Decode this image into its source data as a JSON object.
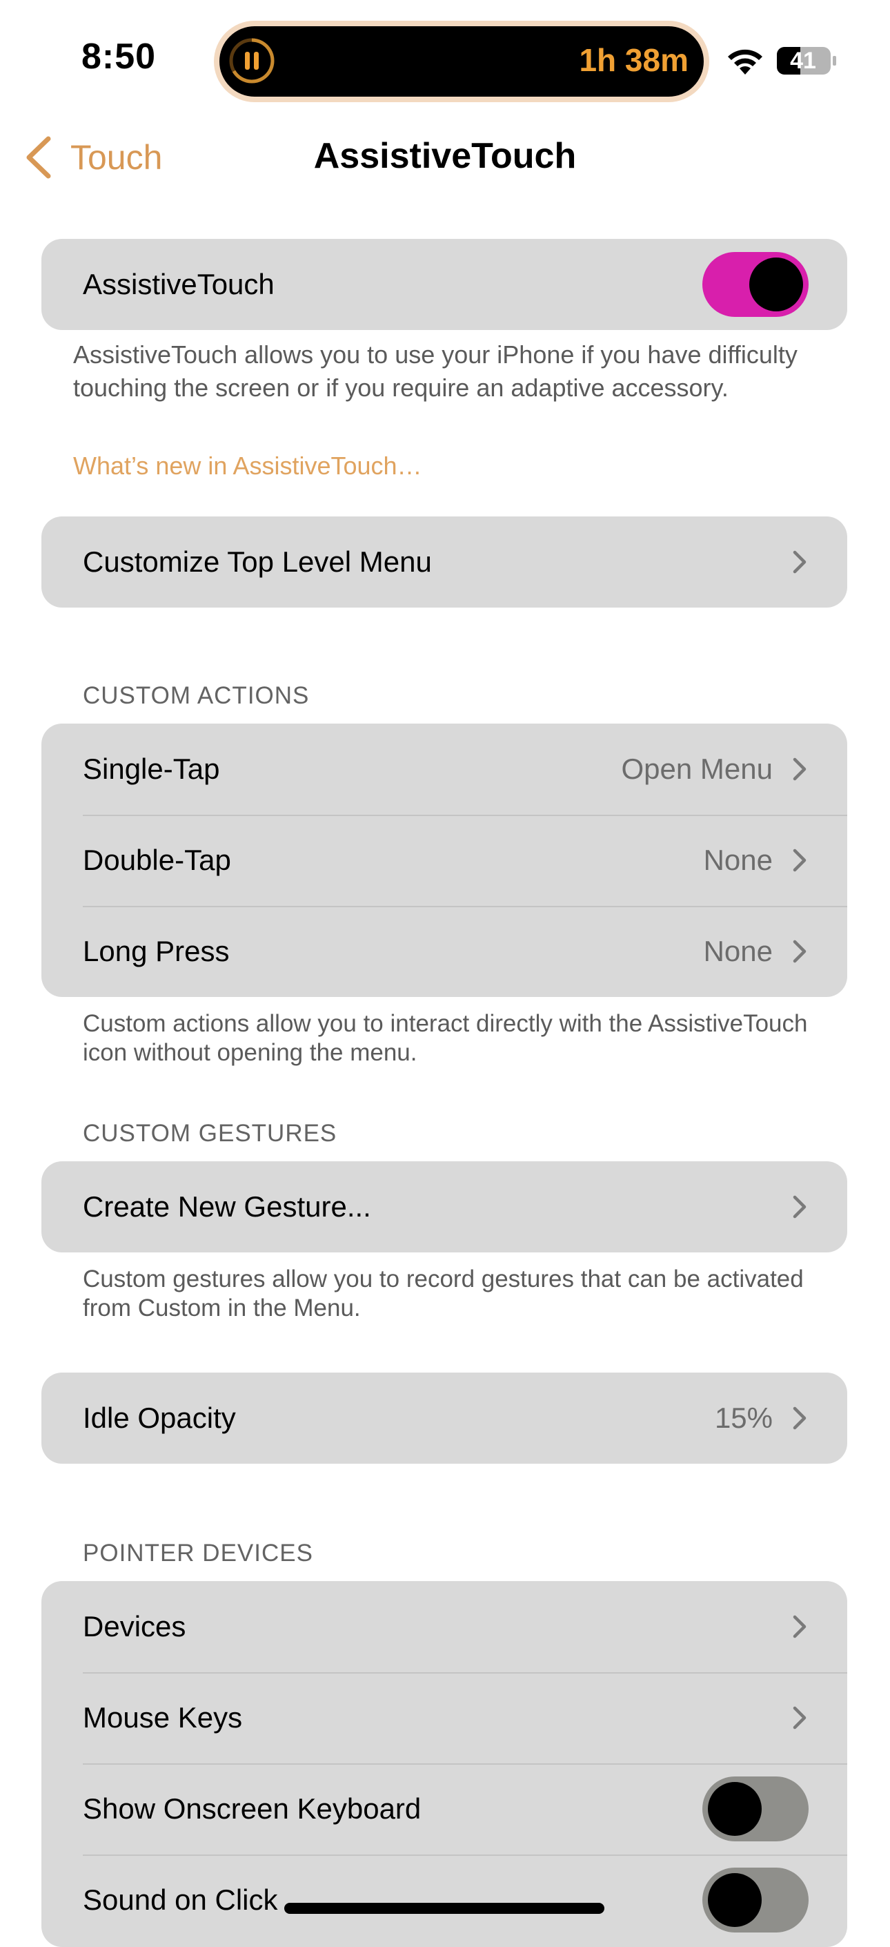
{
  "status_bar": {
    "time": "8:50",
    "live_activity_timer": "1h 38m",
    "battery_level": "41"
  },
  "nav": {
    "back_label": "Touch",
    "title": "AssistiveTouch"
  },
  "main_toggle": {
    "label": "AssistiveTouch",
    "on": true,
    "description": "AssistiveTouch allows you to use your iPhone if you have difficulty touching the screen or if you require an adaptive accessory.",
    "link": "What’s new in AssistiveTouch…"
  },
  "customize": {
    "label": "Customize Top Level Menu"
  },
  "custom_actions": {
    "header": "CUSTOM ACTIONS",
    "rows": [
      {
        "label": "Single-Tap",
        "value": "Open Menu"
      },
      {
        "label": "Double-Tap",
        "value": "None"
      },
      {
        "label": "Long Press",
        "value": "None"
      }
    ],
    "footer": "Custom actions allow you to interact directly with the AssistiveTouch icon without opening the menu."
  },
  "custom_gestures": {
    "header": "CUSTOM GESTURES",
    "rows": [
      {
        "label": "Create New Gesture..."
      }
    ],
    "footer": "Custom gestures allow you to record gestures that can be activated from Custom in the Menu."
  },
  "idle_opacity": {
    "label": "Idle Opacity",
    "value": "15%"
  },
  "pointer_devices": {
    "header": "POINTER DEVICES",
    "rows": [
      {
        "label": "Devices",
        "type": "link"
      },
      {
        "label": "Mouse Keys",
        "type": "link"
      },
      {
        "label": "Show Onscreen Keyboard",
        "type": "toggle",
        "on": false
      },
      {
        "label": "Sound on Click",
        "type": "toggle",
        "on": false
      }
    ]
  },
  "colors": {
    "accent": "#d89855",
    "toggle_on": "#d81fac",
    "group_background": "#d9d9d9"
  }
}
